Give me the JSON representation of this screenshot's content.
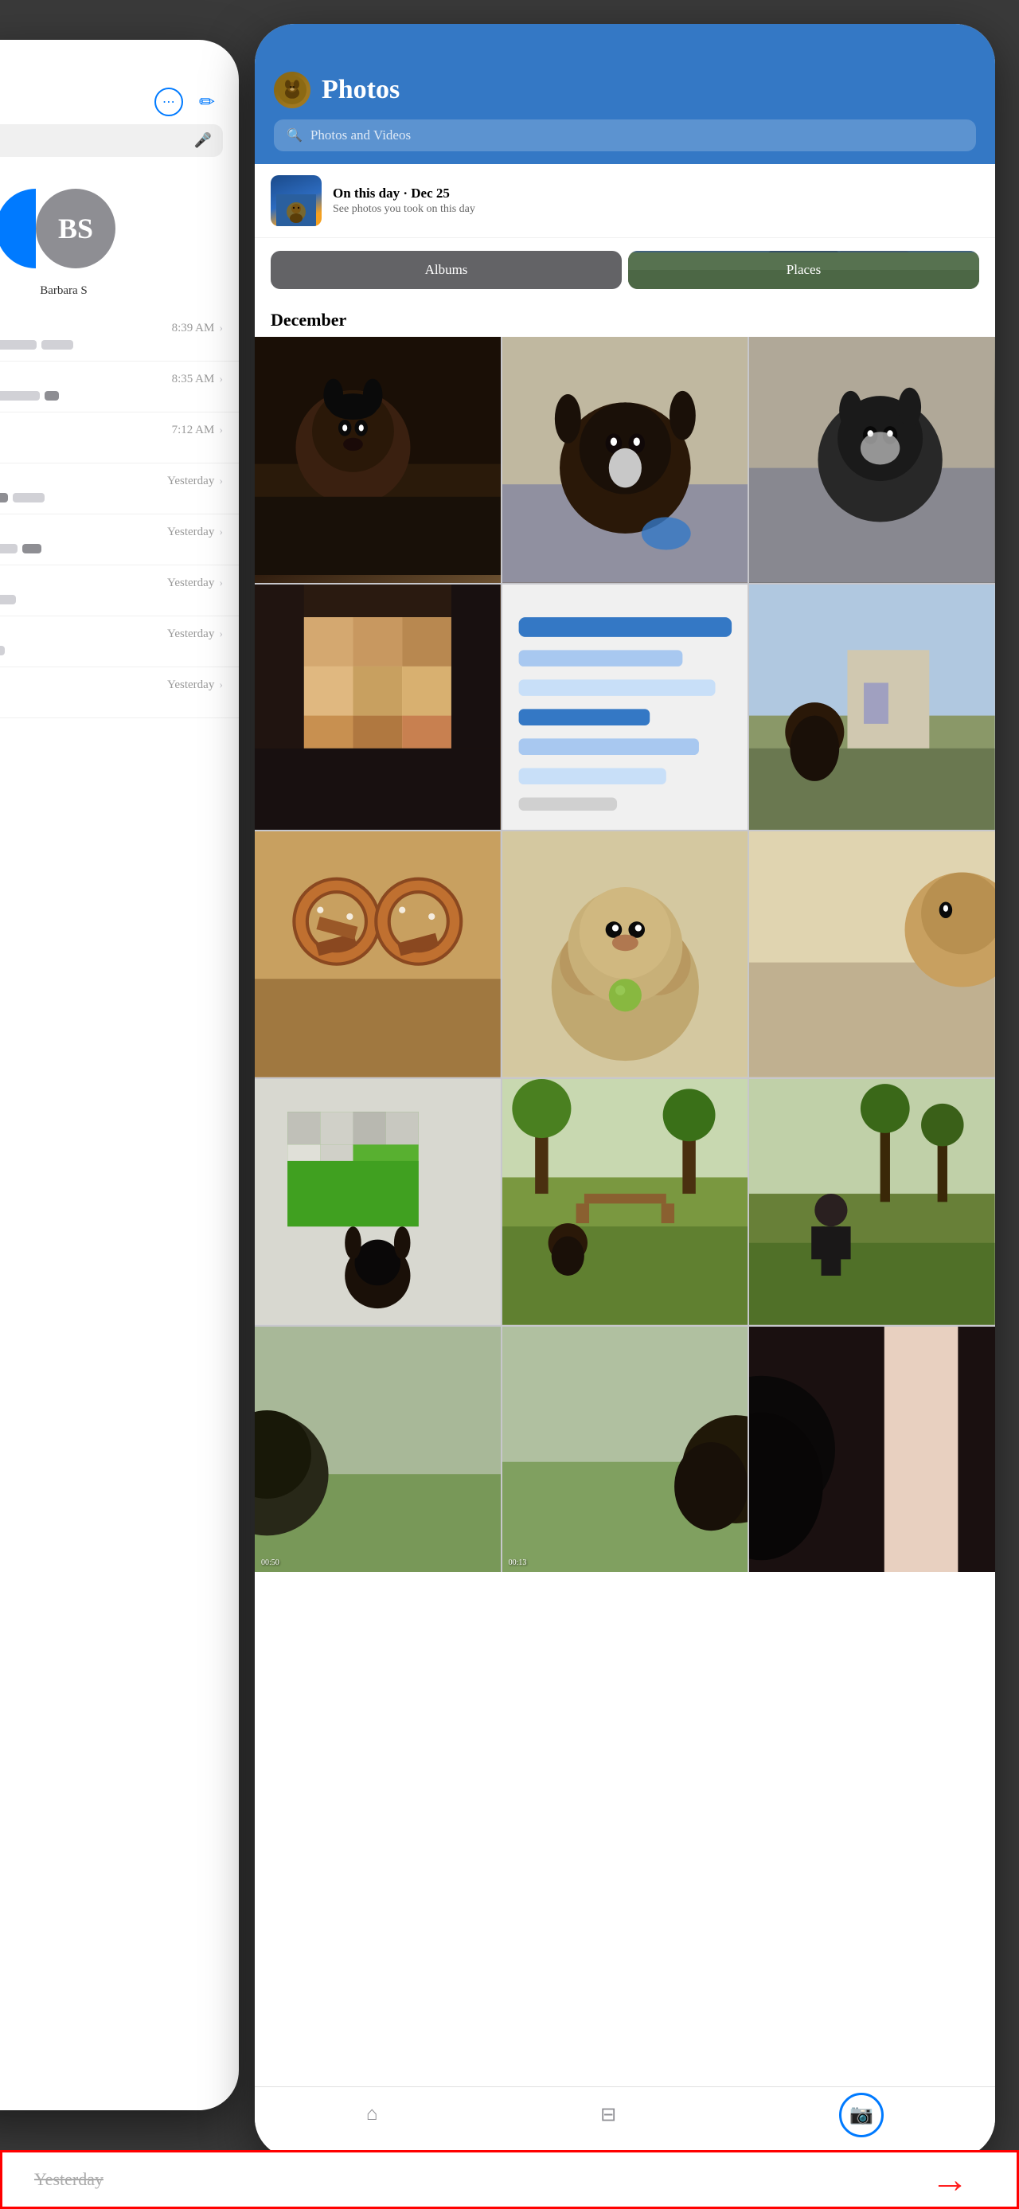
{
  "leftPhone": {
    "header": {
      "ellipsisIcon": "⋯",
      "composeIcon": "✏"
    },
    "searchBar": {
      "micIcon": "🎤"
    },
    "avatar": {
      "initials": "BS",
      "name": "Barbara S"
    },
    "messages": [
      {
        "time": "8:39 AM",
        "previewBlocks": [
          40,
          30,
          50
        ]
      },
      {
        "time": "8:35 AM",
        "previewBlocks": [
          30,
          60,
          20
        ]
      },
      {
        "time": "7:12 AM",
        "previewBlocks": [
          20
        ]
      },
      {
        "time": "Yesterday",
        "previewBlocks": [
          50,
          40
        ]
      },
      {
        "time": "Yesterday",
        "previewBlocks": [
          20,
          40,
          30
        ]
      },
      {
        "time": "Yesterday",
        "previewBlocks": [
          60
        ]
      },
      {
        "time": "Yesterday",
        "previewBlocks": [
          25,
          20
        ]
      },
      {
        "time": "Yesterday",
        "previewBlocks": [
          40
        ]
      }
    ]
  },
  "rightPhone": {
    "header": {
      "title": "Photos",
      "searchPlaceholder": "Photos and Videos"
    },
    "onThisDay": {
      "title": "On this day · Dec 25",
      "subtitle": "See photos you took on this day"
    },
    "sectionButtons": {
      "albums": "Albums",
      "places": "Places"
    },
    "monthLabel": "December",
    "bottomNav": {
      "homeLabel": "Home",
      "filesLabel": "Files",
      "cameraLabel": "Camera"
    }
  },
  "annotation": {
    "text": "Yesterday",
    "arrowSymbol": "→"
  }
}
